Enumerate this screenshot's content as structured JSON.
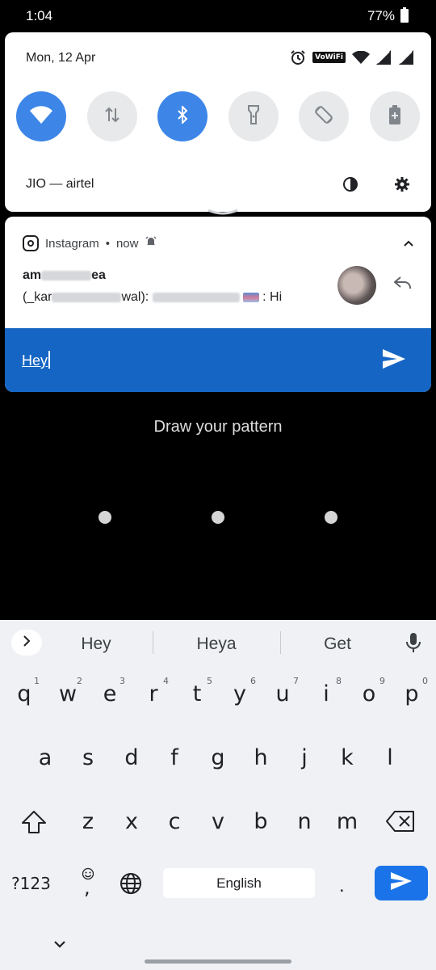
{
  "status_bar": {
    "time": "1:04",
    "battery": "77%"
  },
  "quick_settings": {
    "date": "Mon, 12 Apr",
    "volte_label": "VoWiFi",
    "carrier": "JIO — airtel",
    "tiles": [
      {
        "name": "wifi",
        "on": true
      },
      {
        "name": "mobile-data",
        "on": false
      },
      {
        "name": "bluetooth",
        "on": true
      },
      {
        "name": "flashlight",
        "on": false
      },
      {
        "name": "auto-rotate",
        "on": false
      },
      {
        "name": "battery-saver",
        "on": false
      }
    ]
  },
  "notification": {
    "app": "Instagram",
    "time": "now",
    "title_start": "am",
    "title_end": "ea",
    "body_start": "(_kar",
    "body_mid": "wal):",
    "body_end": "Hi",
    "reply_text": "Hey"
  },
  "lock_screen": {
    "prompt": "Draw your pattern"
  },
  "keyboard": {
    "suggestions": [
      "Hey",
      "Heya",
      "Get"
    ],
    "row1": [
      "q",
      "w",
      "e",
      "r",
      "t",
      "y",
      "u",
      "i",
      "o",
      "p"
    ],
    "row1_hints": [
      "1",
      "2",
      "3",
      "4",
      "5",
      "6",
      "7",
      "8",
      "9",
      "0"
    ],
    "row2": [
      "a",
      "s",
      "d",
      "f",
      "g",
      "h",
      "j",
      "k",
      "l"
    ],
    "row3": [
      "z",
      "x",
      "c",
      "v",
      "b",
      "n",
      "m"
    ],
    "mode_key": "?123",
    "comma_key": ",",
    "space_label": "English",
    "period_key": "."
  },
  "colors": {
    "accent": "#3d86e8",
    "reply_bar": "#1566c4",
    "enter": "#1a73e8"
  }
}
